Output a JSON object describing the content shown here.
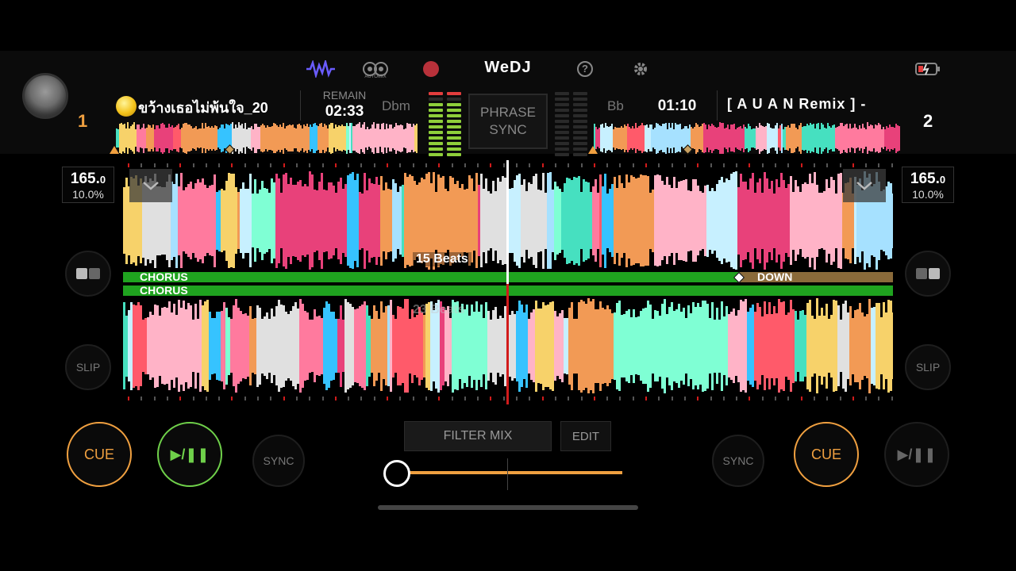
{
  "app": {
    "logo": "WeDJ",
    "automix_label": "AUTOMIX"
  },
  "top_icons": [
    "waveform-icon",
    "automix-icon",
    "record-icon",
    "help-icon",
    "settings-icon",
    "battery-icon"
  ],
  "deck1": {
    "number": "1",
    "title": "ขว้างเธอไม่พ้นใจ_20",
    "remain_label": "REMAIN",
    "remain_time": "02:33",
    "key": "Dbm",
    "bpm_int": "165.",
    "bpm_dec": "0",
    "pitch": "10.0%",
    "beats_label": "15 Beats",
    "phrase": "CHORUS",
    "cue_label": "CUE",
    "play_label": "▶/❚❚",
    "sync_label": "SYNC",
    "slip_label": "SLIP"
  },
  "deck2": {
    "number": "2",
    "title": "[ A U A N  Remix ] -",
    "time": "01:10",
    "key": "Bb",
    "bpm_int": "165.",
    "bpm_dec": "0",
    "pitch": "10.0%",
    "beats_label": "23 Beats",
    "phrase": "CHORUS",
    "next_phrase": "DOWN",
    "cue_label": "CUE",
    "play_label": "▶/❚❚",
    "sync_label": "SYNC",
    "slip_label": "SLIP"
  },
  "center": {
    "phrase_sync": "PHRASE\nSYNC",
    "filter_mix": "FILTER MIX",
    "edit": "EDIT",
    "crossfader_position": 0.0
  },
  "colors": {
    "accent": "#f0a040",
    "play": "#6fd04a",
    "phrase": "#1fa31f",
    "playhead2": "#d21b1b",
    "logo_icon": "#6a5cff"
  }
}
